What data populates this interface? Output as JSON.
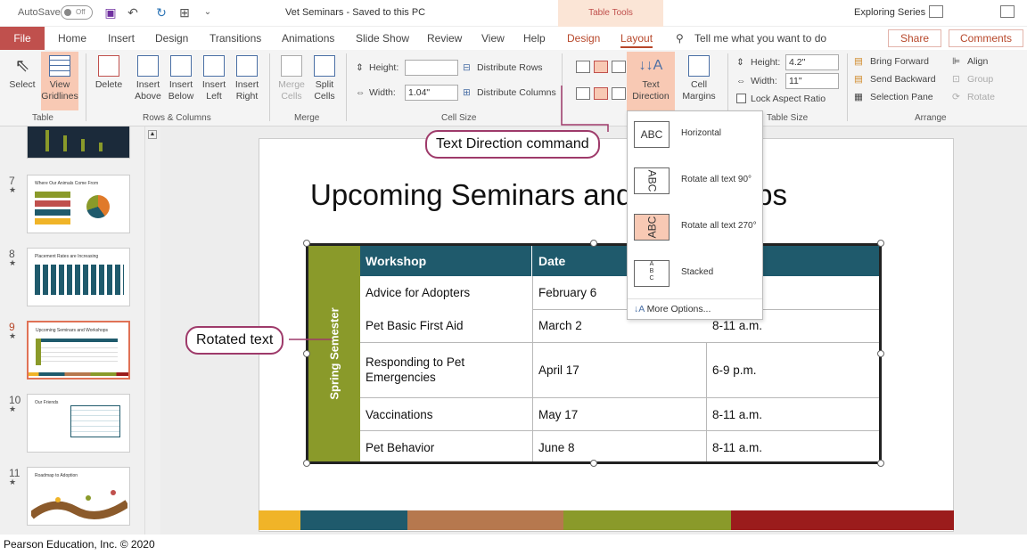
{
  "titlebar": {
    "autosave": "AutoSave",
    "autosave_state": "Off",
    "doc_title": "Vet Seminars  -  Saved to this PC",
    "context_tab_group": "Table Tools",
    "account": "Exploring Series"
  },
  "tabs": {
    "file": "File",
    "items": [
      "Home",
      "Insert",
      "Design",
      "Transitions",
      "Animations",
      "Slide Show",
      "Review",
      "View",
      "Help",
      "Design",
      "Layout"
    ],
    "tell_me": "Tell me what you want to do",
    "share": "Share",
    "comments": "Comments"
  },
  "ribbon": {
    "table": {
      "select": "Select",
      "view_gridlines_1": "View",
      "view_gridlines_2": "Gridlines",
      "group": "Table"
    },
    "rows_columns": {
      "delete": "Delete",
      "insert_above_1": "Insert",
      "insert_above_2": "Above",
      "insert_below_1": "Insert",
      "insert_below_2": "Below",
      "insert_left_1": "Insert",
      "insert_left_2": "Left",
      "insert_right_1": "Insert",
      "insert_right_2": "Right",
      "group": "Rows & Columns"
    },
    "merge": {
      "merge_1": "Merge",
      "merge_2": "Cells",
      "split_1": "Split",
      "split_2": "Cells",
      "group": "Merge"
    },
    "cell_size": {
      "height_label": "Height:",
      "height_value": "",
      "width_label": "Width:",
      "width_value": "1.04\"",
      "distribute_rows": "Distribute Rows",
      "distribute_columns": "Distribute Columns",
      "group": "Cell Size"
    },
    "alignment": {
      "text_direction_1": "Text",
      "text_direction_2": "Direction",
      "cell_margins_1": "Cell",
      "cell_margins_2": "Margins"
    },
    "table_size": {
      "height_label": "Height:",
      "height_value": "4.2\"",
      "width_label": "Width:",
      "width_value": "11\"",
      "lock": "Lock Aspect Ratio",
      "group": "Table Size"
    },
    "arrange": {
      "bring_forward": "Bring Forward",
      "send_backward": "Send Backward",
      "selection_pane": "Selection Pane",
      "align": "Align",
      "group_btn": "Group",
      "rotate": "Rotate",
      "group": "Arrange"
    }
  },
  "thumbnails": [
    {
      "num": "7",
      "title": "Where Our Animals Come From"
    },
    {
      "num": "8",
      "title": "Placement Rates are Increasing"
    },
    {
      "num": "9",
      "title": "Upcoming Seminars and Workshops"
    },
    {
      "num": "10",
      "title": "Our Friends"
    },
    {
      "num": "11",
      "title": "Roadmap to Adoption"
    }
  ],
  "slide": {
    "title": "Upcoming Seminars and Workshops",
    "semester": "Spring Semester",
    "headers": [
      "Workshop",
      "Date",
      ""
    ],
    "rows": [
      [
        "Advice for Adopters",
        "February 6",
        ""
      ],
      [
        "Pet Basic First Aid",
        "March 2",
        "8-11 a.m."
      ],
      [
        "Responding to Pet Emergencies",
        "April 17",
        "6-9 p.m."
      ],
      [
        "Vaccinations",
        "May 17",
        "8-11 a.m."
      ],
      [
        "Pet Behavior",
        "June 8",
        "8-11 a.m."
      ]
    ],
    "band_colors": [
      "#f0b428",
      "#1f5a6c",
      "#b6784e",
      "#8a9a2a",
      "#9b1c1c"
    ]
  },
  "dropdown": {
    "items": [
      {
        "label": "Horizontal",
        "preview": "ABC"
      },
      {
        "label": "Rotate all text 90°",
        "preview": "ABC"
      },
      {
        "label": "Rotate all text 270°",
        "preview": "ABC"
      },
      {
        "label": "Stacked",
        "preview": "A B C"
      }
    ],
    "more": "More Options..."
  },
  "callouts": {
    "text_direction": "Text Direction command",
    "rotated_text": "Rotated text"
  },
  "credit": "Pearson Education, Inc. © 2020"
}
